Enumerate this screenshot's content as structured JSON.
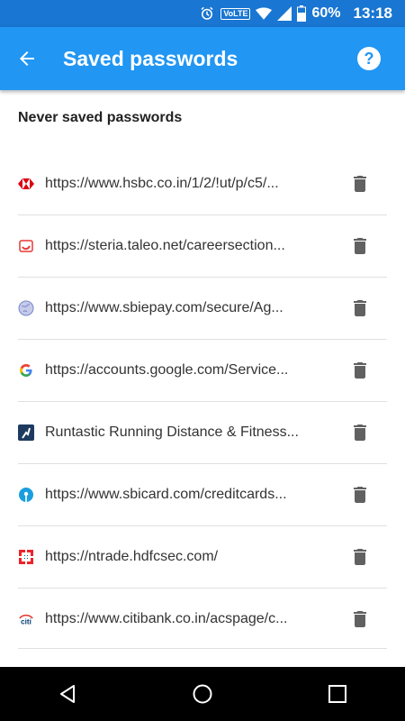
{
  "status_bar": {
    "volte": "VoLTE",
    "battery_percent": "60%",
    "time": "13:18"
  },
  "app_bar": {
    "title": "Saved passwords"
  },
  "section": {
    "title": "Never saved passwords"
  },
  "entries": [
    {
      "label": "https://www.hsbc.co.in/1/2/!ut/p/c5/...",
      "icon": "hsbc-favicon"
    },
    {
      "label": "https://steria.taleo.net/careersection...",
      "icon": "steria-favicon"
    },
    {
      "label": "https://www.sbiepay.com/secure/Ag...",
      "icon": "globe-favicon"
    },
    {
      "label": "https://accounts.google.com/Service...",
      "icon": "google-favicon"
    },
    {
      "label": "Runtastic Running Distance & Fitness...",
      "icon": "runtastic-favicon"
    },
    {
      "label": "https://www.sbicard.com/creditcards...",
      "icon": "sbi-favicon"
    },
    {
      "label": "https://ntrade.hdfcsec.com/",
      "icon": "hdfc-favicon"
    },
    {
      "label": "https://www.citibank.co.in/acspage/c...",
      "icon": "citi-favicon"
    }
  ],
  "colors": {
    "status_bar": "#1976d2",
    "app_bar": "#2196f3",
    "delete_icon": "#616161"
  }
}
